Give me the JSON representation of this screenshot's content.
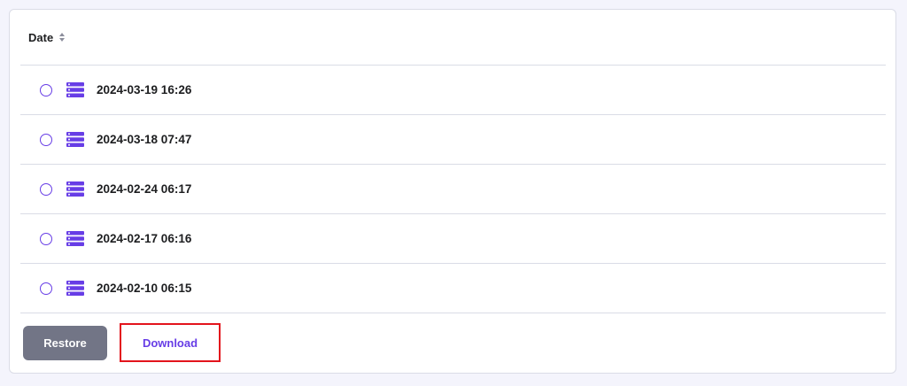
{
  "table": {
    "column_header": "Date",
    "sort_icon": "sort-updown-icon",
    "row_icon": "server-icon",
    "rows": [
      {
        "date": "2024-03-19 16:26"
      },
      {
        "date": "2024-03-18 07:47"
      },
      {
        "date": "2024-02-24 06:17"
      },
      {
        "date": "2024-02-17 06:16"
      },
      {
        "date": "2024-02-10 06:15"
      }
    ]
  },
  "actions": {
    "restore_label": "Restore",
    "download_label": "Download"
  },
  "colors": {
    "accent": "#673de6",
    "restore_bg": "#727586",
    "highlight_border": "#e3141c"
  }
}
